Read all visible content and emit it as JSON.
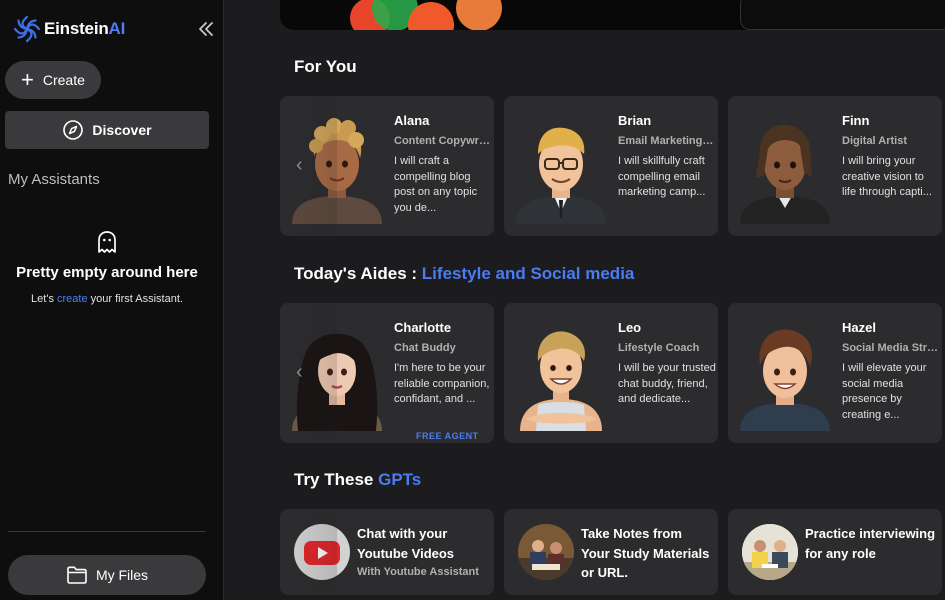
{
  "sidebar": {
    "brand": {
      "name_prefix": "Einstein",
      "name_suffix": "AI"
    },
    "create_label": "Create",
    "discover_label": "Discover",
    "my_assistants_label": "My Assistants",
    "empty_title": "Pretty empty around here",
    "empty_prefix": "Let's ",
    "empty_link": "create",
    "empty_suffix": " your first Assistant.",
    "files_label": "My Files"
  },
  "main": {
    "for_you": {
      "title": "For You",
      "cards": [
        {
          "name": "Alana",
          "role": "Content Copywriter",
          "desc": "I will craft a compelling blog post on any topic you de..."
        },
        {
          "name": "Brian",
          "role": "Email Marketing Expert",
          "desc": "I will skillfully craft compelling email marketing camp..."
        },
        {
          "name": "Finn",
          "role": "Digital Artist",
          "desc": "I will bring your creative vision to life through capti..."
        }
      ]
    },
    "todays_aides": {
      "title_prefix": "Today's Aides : ",
      "title_accent": "Lifestyle and Social media",
      "free_agent_label": "FREE AGENT",
      "cards": [
        {
          "name": "Charlotte",
          "role": "Chat Buddy",
          "desc": "I'm here to be your reliable companion, confidant, and ..."
        },
        {
          "name": "Leo",
          "role": "Lifestyle Coach",
          "desc": "I will be your trusted chat buddy, friend, and dedicate..."
        },
        {
          "name": "Hazel",
          "role": "Social Media Strategist",
          "desc": "I will elevate your social media presence by creating e..."
        }
      ]
    },
    "gpts": {
      "title_prefix": "Try These ",
      "title_accent": "GPTs",
      "cards": [
        {
          "title": "Chat with your Youtube Videos",
          "subtitle": "With Youtube Assistant"
        },
        {
          "title": "Take Notes from Your Study Materials or URL.",
          "subtitle": ""
        },
        {
          "title": "Practice interviewing for any role",
          "subtitle": ""
        }
      ]
    }
  },
  "colors": {
    "accent": "#4a7cf0",
    "sidebar_bg": "#0e0e0f",
    "main_bg": "#1c1c1e",
    "card_bg": "#2c2c2e",
    "button_bg": "#3a3a3c"
  },
  "icons": [
    "brand-logo-icon",
    "collapse-chevrons-icon",
    "plus-icon",
    "compass-icon",
    "ghost-icon",
    "folder-icon",
    "carousel-prev-icon",
    "youtube-icon"
  ]
}
